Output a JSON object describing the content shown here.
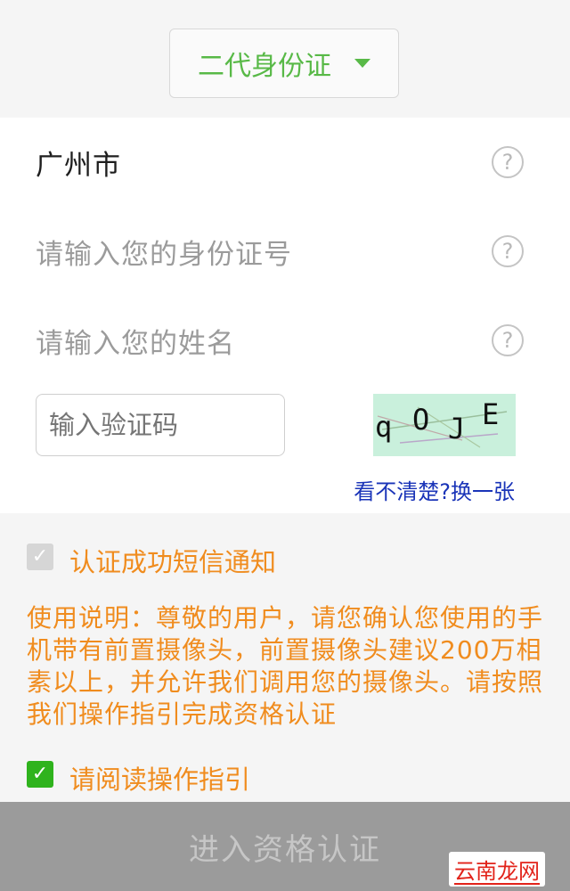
{
  "id_type": {
    "selected": "二代身份证",
    "options_visible": false
  },
  "form": {
    "city": "广州市",
    "id_placeholder": "请输入您的身份证号",
    "name_placeholder": "请输入您的姓名",
    "captcha_placeholder": "输入验证码",
    "captcha_chars": [
      "q",
      "O",
      "J",
      "E"
    ],
    "refresh_link": "看不清楚?换一张",
    "help_glyph": "?"
  },
  "options": {
    "sms_notify": {
      "label": "认证成功短信通知",
      "checked": true,
      "disabled": true
    },
    "notice": "使用说明：尊敬的用户，请您确认您使用的手机带有前置摄像头，前置摄像头建议200万相素以上，并允许我们调用您的摄像头。请按照我们操作指引完成资格认证",
    "read_guide": {
      "label": "请阅读操作指引",
      "checked": true
    }
  },
  "submit_label": "进入资格认证",
  "watermark": "云南龙网",
  "colors": {
    "accent_green": "#58b947",
    "notice_orange": "#f08c1e",
    "link_blue": "#1a34b8",
    "checkbox_green": "#2fb31d",
    "submit_gray": "#9b9b9b"
  },
  "icons": {
    "dropdown": "caret-down-icon",
    "help": "question-circle-icon",
    "check": "check-icon"
  }
}
